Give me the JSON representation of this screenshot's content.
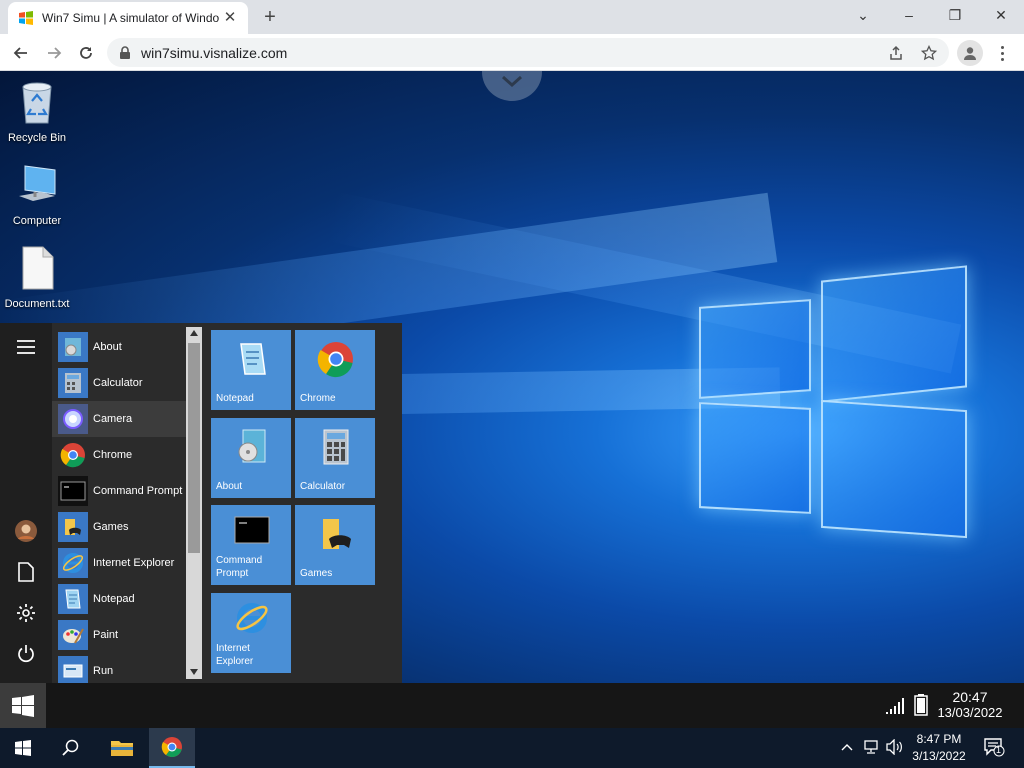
{
  "browser": {
    "tab_title": "Win7 Simu | A simulator of Windo",
    "url": "win7simu.visnalize.com"
  },
  "desktop_icons": [
    {
      "label": "Recycle Bin",
      "icon": "recycle-bin-icon"
    },
    {
      "label": "Computer",
      "icon": "computer-icon"
    },
    {
      "label": "Document.txt",
      "icon": "document-icon"
    }
  ],
  "start_menu": {
    "apps": [
      {
        "label": "About",
        "icon": "about-icon"
      },
      {
        "label": "Calculator",
        "icon": "calculator-icon"
      },
      {
        "label": "Camera",
        "icon": "camera-icon",
        "highlighted": true
      },
      {
        "label": "Chrome",
        "icon": "chrome-icon"
      },
      {
        "label": "Command Prompt",
        "icon": "command-prompt-icon"
      },
      {
        "label": "Games",
        "icon": "games-icon"
      },
      {
        "label": "Internet Explorer",
        "icon": "internet-explorer-icon"
      },
      {
        "label": "Notepad",
        "icon": "notepad-icon"
      },
      {
        "label": "Paint",
        "icon": "paint-icon"
      },
      {
        "label": "Run",
        "icon": "run-icon"
      }
    ],
    "tiles": [
      {
        "label": "Notepad",
        "icon": "notepad-icon"
      },
      {
        "label": "Chrome",
        "icon": "chrome-icon"
      },
      {
        "label": "About",
        "icon": "about-icon"
      },
      {
        "label": "Calculator",
        "icon": "calculator-icon"
      },
      {
        "label": "Command\nPrompt",
        "icon": "command-prompt-icon"
      },
      {
        "label": "Games",
        "icon": "games-icon"
      },
      {
        "label": "Internet\nExplorer",
        "icon": "internet-explorer-icon"
      }
    ]
  },
  "sim_taskbar": {
    "time": "20:47",
    "date": "13/03/2022"
  },
  "taskbar": {
    "time": "8:47 PM",
    "date": "3/13/2022",
    "notification_count": "1"
  },
  "colors": {
    "tile": "#4a8fd6",
    "start_menu_bg": "#2b2b2b",
    "taskbar_bg": "#0e1a2b"
  }
}
